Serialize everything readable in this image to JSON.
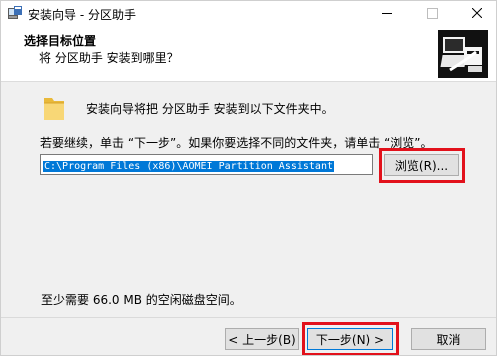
{
  "window": {
    "title": "安装向导 - 分区助手"
  },
  "header": {
    "title": "选择目标位置",
    "subtitle": "将 分区助手 安装到哪里？"
  },
  "body": {
    "folder_message": "安装向导将把 分区助手 安装到以下文件夹中。",
    "instruction": "若要继续，单击 “下一步”。如果你要选择不同的文件夹，请单击 “浏览”。",
    "install_path": "C:\\Program Files (x86)\\AOMEI Partition Assistant",
    "browse_label": "浏览(R)...",
    "space_required": "至少需要 66.0 MB 的空闲磁盘空间。"
  },
  "footer": {
    "back_label": "< 上一步(B)",
    "next_label": "下一步(N) >",
    "cancel_label": "取消"
  },
  "icons": {
    "app": "installer-icon",
    "header": "computer-install-icon",
    "folder": "folder-icon"
  },
  "colors": {
    "selection": "#0078d7",
    "highlight_box": "#e2111b",
    "button_face": "#e1e1e1"
  }
}
